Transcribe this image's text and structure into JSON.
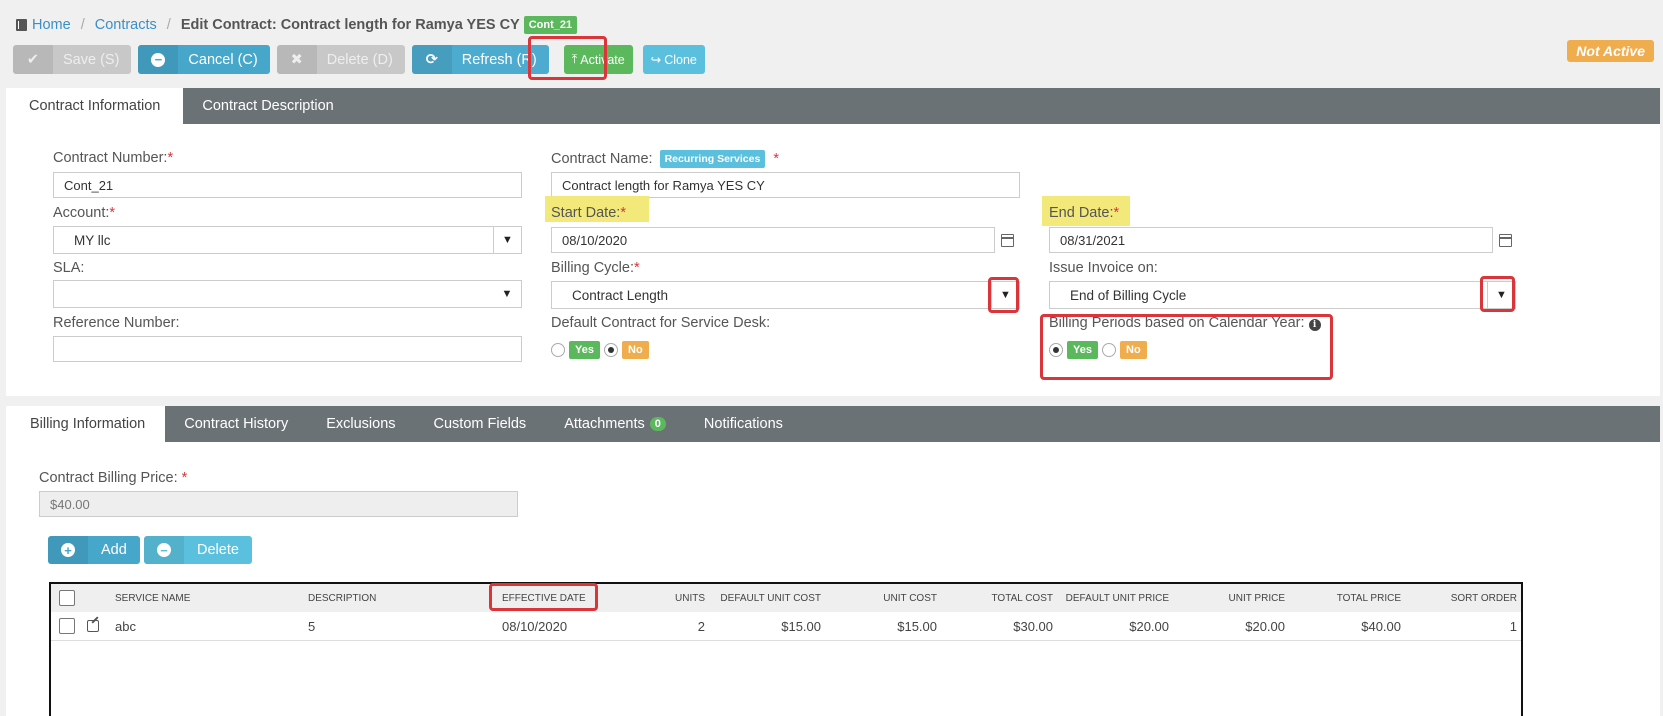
{
  "breadcrumb": {
    "home": "Home",
    "contracts": "Contracts",
    "current": "Edit Contract: Contract length for Ramya YES CY",
    "badge": "Cont_21"
  },
  "toolbar": {
    "save": "Save (S)",
    "cancel": "Cancel (C)",
    "delete": "Delete (D)",
    "refresh": "Refresh (R)",
    "activate": "Activate",
    "clone": "Clone"
  },
  "status": "Not Active",
  "top_tabs": [
    "Contract Information",
    "Contract Description"
  ],
  "form": {
    "contract_number_label": "Contract Number:",
    "contract_number": "Cont_21",
    "contract_name_label": "Contract Name:",
    "contract_name_chip": "Recurring Services",
    "contract_name": "Contract length for Ramya YES CY",
    "account_label": "Account:",
    "account": "MY llc",
    "start_date_label": "Start Date:",
    "start_date": "08/10/2020",
    "end_date_label": "End Date:",
    "end_date": "08/31/2021",
    "sla_label": "SLA:",
    "sla": "",
    "billing_cycle_label": "Billing Cycle:",
    "billing_cycle": "Contract Length",
    "issue_invoice_label": "Issue Invoice on:",
    "issue_invoice": "End of Billing Cycle",
    "reference_label": "Reference Number:",
    "reference": "",
    "default_contract_label": "Default Contract for Service Desk:",
    "billing_periods_label": "Billing Periods based on Calendar Year:",
    "yes": "Yes",
    "no": "No",
    "required_mark": "*"
  },
  "bottom_tabs": {
    "billing": "Billing Information",
    "history": "Contract History",
    "exclusions": "Exclusions",
    "custom": "Custom Fields",
    "attachments": "Attachments",
    "attachments_count": "0",
    "notifications": "Notifications"
  },
  "billing": {
    "price_label": "Contract Billing Price:",
    "price": "$40.00",
    "add": "Add",
    "delete": "Delete"
  },
  "grid": {
    "headers": {
      "service_name": "SERVICE NAME",
      "description": "DESCRIPTION",
      "effective_date": "EFFECTIVE DATE",
      "units": "UNITS",
      "default_unit_cost": "DEFAULT UNIT COST",
      "unit_cost": "UNIT COST",
      "total_cost": "TOTAL COST",
      "default_unit_price": "DEFAULT UNIT PRICE",
      "unit_price": "UNIT PRICE",
      "total_price": "TOTAL PRICE",
      "sort_order": "SORT ORDER"
    },
    "rows": [
      {
        "service_name": "abc",
        "description": "5",
        "effective_date": "08/10/2020",
        "units": "2",
        "default_unit_cost": "$15.00",
        "unit_cost": "$15.00",
        "total_cost": "$30.00",
        "default_unit_price": "$20.00",
        "unit_price": "$20.00",
        "total_price": "$40.00",
        "sort_order": "1"
      }
    ]
  },
  "colors": {
    "accent_blue": "#46a7cb",
    "green": "#5cb85c",
    "orange": "#f0ad4e",
    "highlight_red": "#d9353a",
    "highlight_yellow": "#f3e97a",
    "tabbar": "#6b7275"
  }
}
